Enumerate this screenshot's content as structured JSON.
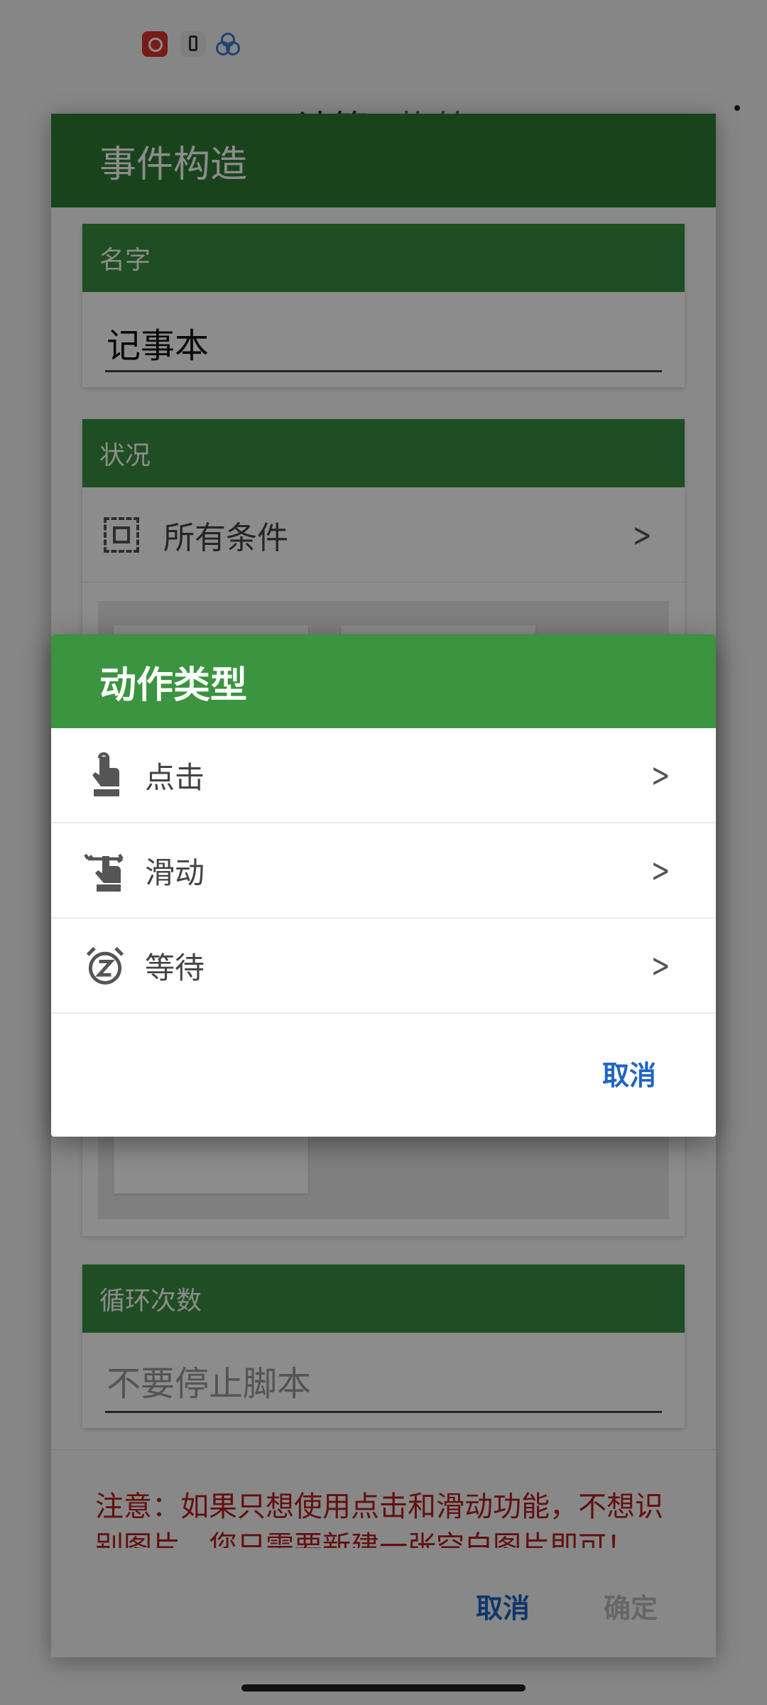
{
  "app": {
    "title_part1": "计算",
    "title_part2": "构筑"
  },
  "event_dialog": {
    "title": "事件构造",
    "name_section": {
      "header": "名字",
      "value": "记事本"
    },
    "condition_section": {
      "header": "状况",
      "row_label": "所有条件"
    },
    "loop_section": {
      "header": "循环次数",
      "placeholder": "不要停止脚本"
    },
    "note": "注意：如果只想使用点击和滑动功能，不想识别图片，您只需要新建一张空白图片即可！",
    "cancel_label": "取消",
    "confirm_label": "确定"
  },
  "action_dialog": {
    "title": "动作类型",
    "options": [
      {
        "label": "点击",
        "icon": "tap-hand-icon"
      },
      {
        "label": "滑动",
        "icon": "swipe-hand-icon"
      },
      {
        "label": "等待",
        "icon": "alarm-snooze-icon"
      }
    ],
    "cancel_label": "取消"
  },
  "colors": {
    "header_dark": "#2e7d32",
    "header": "#3b943f",
    "accent_blue": "#1e63c5",
    "note_red": "#b71c1c"
  }
}
